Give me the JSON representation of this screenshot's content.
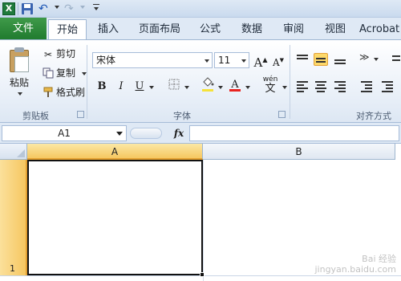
{
  "qat": {
    "excel_logo": "X",
    "icons": [
      "excel-icon",
      "save-icon",
      "undo-icon",
      "redo-icon",
      "customize-icon"
    ]
  },
  "tabs": [
    "文件",
    "开始",
    "插入",
    "页面布局",
    "公式",
    "数据",
    "审阅",
    "视图",
    "Acrobat"
  ],
  "clipboard": {
    "paste": "粘贴",
    "cut": "剪切",
    "copy": "复制",
    "format_painter": "格式刷",
    "group_label": "剪贴板"
  },
  "font": {
    "name": "宋体",
    "size": "11",
    "grow": "A",
    "shrink": "A",
    "bold": "B",
    "italic": "I",
    "underline": "U",
    "color_letter": "A",
    "wen": "wén",
    "phonetic": "文",
    "group_label": "字体",
    "font_color": "#e8231f",
    "fill_color": "#f5e23a"
  },
  "alignment": {
    "group_label": "对齐方式"
  },
  "formula_bar": {
    "name_box": "A1",
    "fx": "fx",
    "formula": ""
  },
  "grid": {
    "columns": [
      "A",
      "B"
    ],
    "rows": [
      "1"
    ],
    "selected_cell": "A1"
  },
  "watermark": {
    "line1": "Bai 经验",
    "line2": "jingyan.baidu.com"
  }
}
